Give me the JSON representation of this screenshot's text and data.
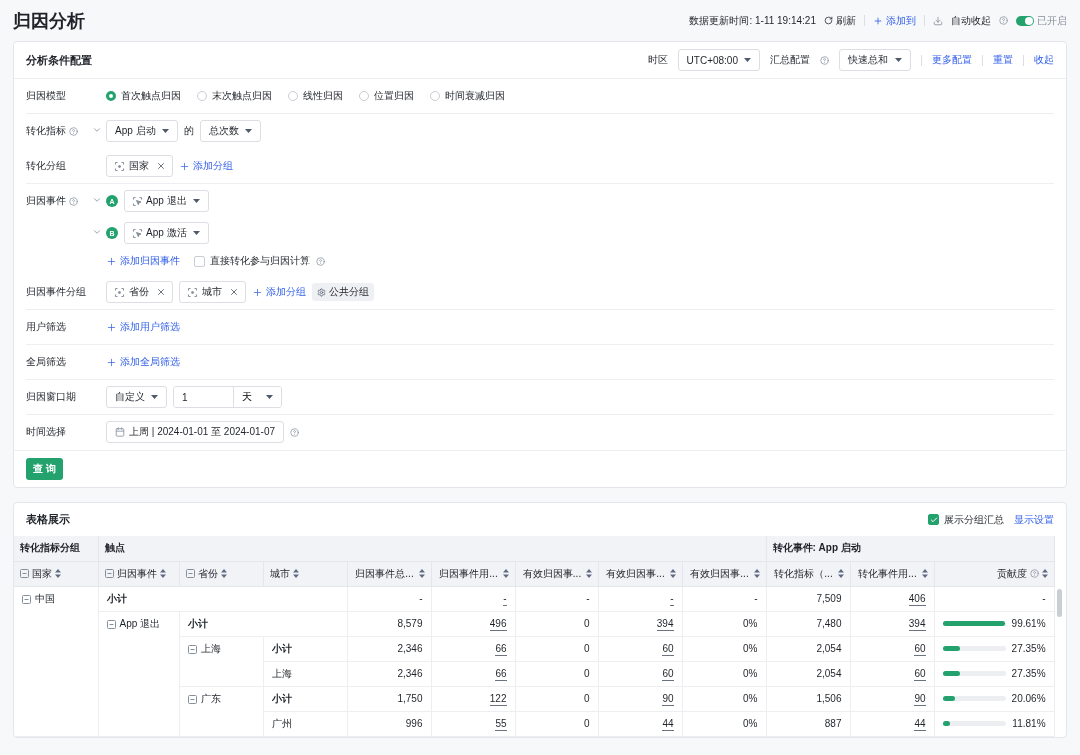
{
  "header": {
    "title": "归因分析",
    "updated": "数据更新时间: 1-11 19:14:21",
    "refresh": "刷新",
    "add_to": "添加到",
    "auto_collapse": "自动收起",
    "auto_collapse_on": true,
    "auto_collapse_state": "已开启"
  },
  "config": {
    "title": "分析条件配置",
    "timezone_label": "时区",
    "timezone": "UTC+08:00",
    "summary_label": "汇总配置",
    "summary": "快速总和",
    "links": [
      "更多配置",
      "重置",
      "收起"
    ],
    "rows": [
      {
        "kind": "radio",
        "label": "归因模型",
        "help": false,
        "divider_after": true,
        "options": [
          {
            "label": "首次触点归因",
            "selected": true
          },
          {
            "label": "末次触点归因",
            "selected": false
          },
          {
            "label": "线性归因",
            "selected": false
          },
          {
            "label": "位置归因",
            "selected": false
          },
          {
            "label": "时间衰减归因",
            "selected": false
          }
        ]
      },
      {
        "kind": "metric",
        "label": "转化指标",
        "help": true,
        "divider_after": false,
        "event": "App 启动",
        "joiner": "的",
        "measure": "总次数"
      },
      {
        "kind": "tags",
        "label": "转化分组",
        "help": false,
        "divider_after": true,
        "tags": [
          "国家"
        ],
        "add": "添加分组"
      },
      {
        "kind": "events",
        "label": "归因事件",
        "help": true,
        "divider_after": false,
        "events": [
          {
            "badge": "A",
            "name": "App 退出"
          },
          {
            "badge": "B",
            "name": "App 激活"
          }
        ],
        "add": "添加归因事件",
        "checkbox": {
          "label": "直接转化参与归因计算",
          "checked": false
        }
      },
      {
        "kind": "tags",
        "label": "归因事件分组",
        "help": false,
        "divider_after": true,
        "tags": [
          "省份",
          "城市"
        ],
        "add": "添加分组",
        "extra": "公共分组"
      },
      {
        "kind": "add",
        "label": "用户筛选",
        "help": false,
        "divider_after": true,
        "add": "添加用户筛选"
      },
      {
        "kind": "add",
        "label": "全局筛选",
        "help": false,
        "divider_after": true,
        "add": "添加全局筛选"
      },
      {
        "kind": "window",
        "label": "归因窗口期",
        "help": false,
        "divider_after": true,
        "mode": "自定义",
        "value": "1",
        "unit": "天"
      },
      {
        "kind": "date",
        "label": "时间选择",
        "help": false,
        "divider_after": false,
        "range": "上周 | 2024-01-01 至 2024-01-07"
      }
    ],
    "query": "查 询"
  },
  "table_card": {
    "title": "表格展示",
    "show_summary": {
      "label": "展示分组汇总",
      "checked": true
    },
    "settings": "显示设置",
    "groups": [
      {
        "label": "转化指标分组",
        "columns": [
          {
            "label": "国家",
            "kind": "dimension",
            "expanded": true
          }
        ]
      },
      {
        "label": "触点",
        "columns": [
          {
            "label": "归因事件",
            "kind": "dimension",
            "expanded": true
          },
          {
            "label": "省份",
            "kind": "dimension",
            "expanded": true
          },
          {
            "label": "城市",
            "kind": "dimension"
          },
          {
            "label": "归因事件总...",
            "kind": "metric",
            "underlined": false
          },
          {
            "label": "归因事件用...",
            "kind": "metric",
            "underlined": true
          },
          {
            "label": "有效归因事...",
            "kind": "metric",
            "underlined": false
          },
          {
            "label": "有效归因事...",
            "kind": "metric",
            "underlined": true
          },
          {
            "label": "有效归因事...",
            "kind": "metric",
            "underlined": false
          }
        ]
      },
      {
        "label": "转化事件: App 启动",
        "columns": [
          {
            "label": "转化指标（...",
            "kind": "metric",
            "underlined": false
          },
          {
            "label": "转化事件用...",
            "kind": "metric",
            "underlined": true
          },
          {
            "label": "贡献度",
            "kind": "share"
          }
        ]
      }
    ],
    "rows": [
      {
        "label": "中国",
        "expanded": true,
        "subtotal": "小计",
        "values": [
          "-",
          "-",
          "-",
          "-",
          "-",
          "7,509",
          "406"
        ],
        "share": {
          "reading": "-"
        },
        "children": [
          {
            "label": "App 退出",
            "expanded": true,
            "subtotal": "小计",
            "values": [
              "8,579",
              "496",
              "0",
              "394",
              "0%",
              "7,480",
              "394"
            ],
            "share": {
              "level": 0.9961,
              "reading": "99.61%"
            },
            "children": [
              {
                "label": "上海",
                "expanded": true,
                "subtotal": "小计",
                "values": [
                  "2,346",
                  "66",
                  "0",
                  "60",
                  "0%",
                  "2,054",
                  "60"
                ],
                "share": {
                  "level": 0.2735,
                  "reading": "27.35%"
                },
                "children": [
                  {
                    "label": "上海",
                    "values": [
                      "2,346",
                      "66",
                      "0",
                      "60",
                      "0%",
                      "2,054",
                      "60"
                    ],
                    "share": {
                      "level": 0.2735,
                      "reading": "27.35%"
                    }
                  }
                ]
              },
              {
                "label": "广东",
                "expanded": true,
                "subtotal": "小计",
                "values": [
                  "1,750",
                  "122",
                  "0",
                  "90",
                  "0%",
                  "1,506",
                  "90"
                ],
                "share": {
                  "level": 0.2006,
                  "reading": "20.06%"
                },
                "children": [
                  {
                    "label": "广州",
                    "values": [
                      "996",
                      "55",
                      "0",
                      "44",
                      "0%",
                      "887",
                      "44"
                    ],
                    "share": {
                      "level": 0.1181,
                      "reading": "11.81%"
                    }
                  }
                ]
              }
            ]
          }
        ]
      }
    ]
  }
}
